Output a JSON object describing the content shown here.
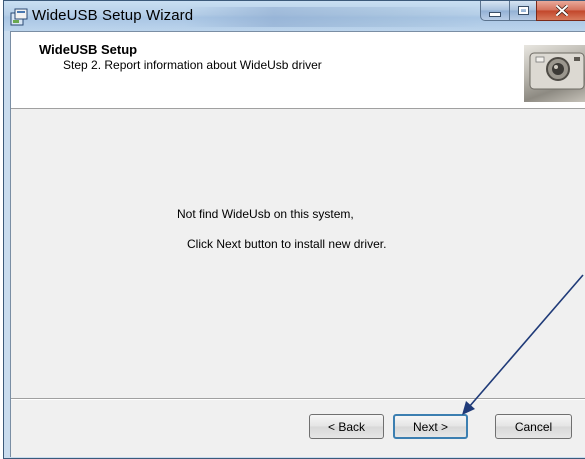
{
  "window": {
    "title": "WideUSB Setup Wizard",
    "app_icon": "setup-installer-icon"
  },
  "header": {
    "title": "WideUSB Setup",
    "subtitle": "Step 2. Report information about WideUsb driver",
    "image": "camera-photo"
  },
  "body": {
    "line1": "Not find WideUsb on this system,",
    "line2": "Click Next button to install new driver."
  },
  "buttons": {
    "back": "< Back",
    "next": "Next >",
    "cancel": "Cancel"
  },
  "annotation": {
    "type": "arrow",
    "points_to": "next-button",
    "color": "#1f3a78"
  }
}
